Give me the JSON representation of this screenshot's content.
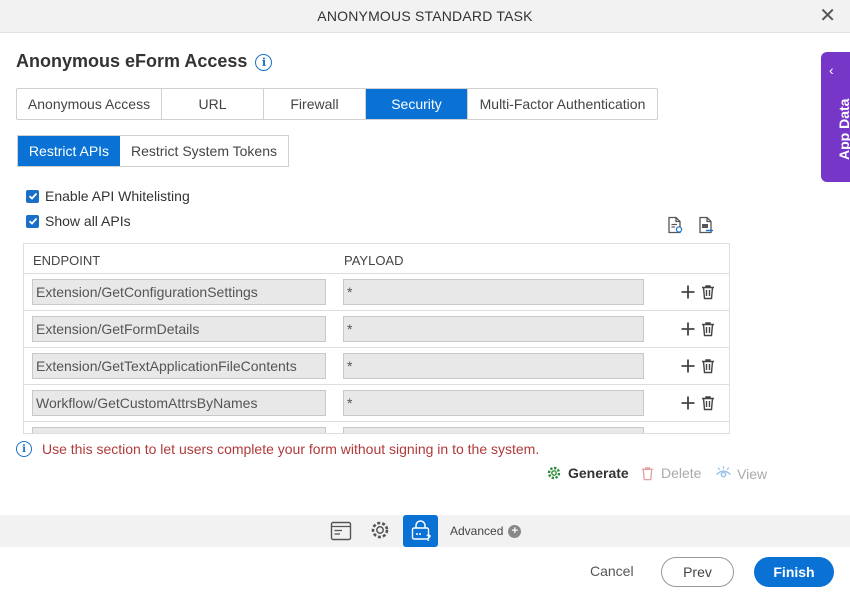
{
  "dialog": {
    "title": "ANONYMOUS STANDARD TASK",
    "close_icon": "close-icon"
  },
  "heading": {
    "text": "Anonymous eForm Access",
    "info_icon": "info-icon"
  },
  "tabs": [
    {
      "label": "Anonymous Access",
      "active": false
    },
    {
      "label": "URL",
      "active": false
    },
    {
      "label": "Firewall",
      "active": false
    },
    {
      "label": "Security",
      "active": true
    },
    {
      "label": "Multi-Factor Authentication",
      "active": false
    }
  ],
  "subtabs": [
    {
      "label": "Restrict APIs",
      "active": true
    },
    {
      "label": "Restrict System Tokens",
      "active": false
    }
  ],
  "checks": {
    "enable_whitelisting": {
      "label": "Enable API Whitelisting",
      "checked": true
    },
    "show_all": {
      "label": "Show all APIs",
      "checked": true
    }
  },
  "grid": {
    "headers": {
      "endpoint": "ENDPOINT",
      "payload": "PAYLOAD"
    },
    "rows": [
      {
        "endpoint": "Extension/GetConfigurationSettings",
        "payload": "*"
      },
      {
        "endpoint": "Extension/GetFormDetails",
        "payload": "*"
      },
      {
        "endpoint": "Extension/GetTextApplicationFileContents",
        "payload": "*"
      },
      {
        "endpoint": "Workflow/GetCustomAttrsByNames",
        "payload": "*"
      }
    ]
  },
  "note": "Use this section to let users complete your form without signing in to the system.",
  "actions": {
    "generate": "Generate",
    "delete": "Delete",
    "view": "View"
  },
  "toolbar": {
    "advanced": "Advanced"
  },
  "footer": {
    "cancel": "Cancel",
    "prev": "Prev",
    "finish": "Finish"
  },
  "side_panel": {
    "label": "App Data"
  },
  "colors": {
    "primary": "#0a72d5",
    "side_panel": "#7636c8",
    "note": "#b03a3a",
    "generate_icon": "#2e8b3a"
  }
}
